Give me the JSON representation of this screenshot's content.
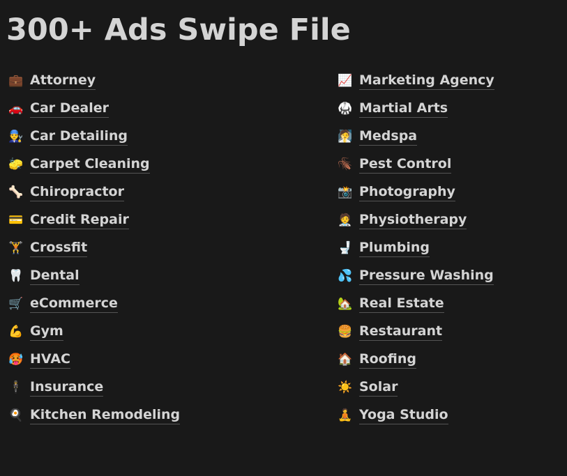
{
  "title": "300+ Ads Swipe File",
  "left_items": [
    {
      "icon": "briefcase-icon",
      "emoji": "💼",
      "label": "Attorney"
    },
    {
      "icon": "car-icon",
      "emoji": "🚗",
      "label": "Car Dealer"
    },
    {
      "icon": "mechanic-icon",
      "emoji": "👨‍🔧",
      "label": "Car Detailing"
    },
    {
      "icon": "sponge-icon",
      "emoji": "🧽",
      "label": "Carpet Cleaning"
    },
    {
      "icon": "bone-icon",
      "emoji": "🦴",
      "label": "Chiropractor"
    },
    {
      "icon": "credit-card-icon",
      "emoji": "💳",
      "label": "Credit Repair"
    },
    {
      "icon": "weightlifter-icon",
      "emoji": "🏋️",
      "label": "Crossfit"
    },
    {
      "icon": "tooth-icon",
      "emoji": "🦷",
      "label": "Dental"
    },
    {
      "icon": "shopping-cart-icon",
      "emoji": "🛒",
      "label": "eCommerce"
    },
    {
      "icon": "flexed-biceps-icon",
      "emoji": "💪",
      "label": "Gym"
    },
    {
      "icon": "hot-face-icon",
      "emoji": "🥵",
      "label": "HVAC"
    },
    {
      "icon": "person-in-suit-icon",
      "emoji": "🕴️",
      "label": "Insurance"
    },
    {
      "icon": "frying-pan-icon",
      "emoji": "🍳",
      "label": "Kitchen Remodeling"
    }
  ],
  "right_items": [
    {
      "icon": "chart-increasing-icon",
      "emoji": "📈",
      "label": "Marketing Agency"
    },
    {
      "icon": "martial-arts-uniform-icon",
      "emoji": "🥋",
      "label": "Martial Arts"
    },
    {
      "icon": "person-in-steamy-room-icon",
      "emoji": "🧖",
      "label": "Medspa"
    },
    {
      "icon": "cockroach-icon",
      "emoji": "🪳",
      "label": "Pest Control"
    },
    {
      "icon": "camera-flash-icon",
      "emoji": "📸",
      "label": "Photography"
    },
    {
      "icon": "health-worker-icon",
      "emoji": "🧑‍⚕️",
      "label": "Physiotherapy"
    },
    {
      "icon": "toilet-icon",
      "emoji": "🚽",
      "label": "Plumbing"
    },
    {
      "icon": "sweat-droplets-icon",
      "emoji": "💦",
      "label": "Pressure Washing"
    },
    {
      "icon": "house-with-garden-icon",
      "emoji": "🏡",
      "label": "Real Estate"
    },
    {
      "icon": "hamburger-icon",
      "emoji": "🍔",
      "label": "Restaurant"
    },
    {
      "icon": "house-icon",
      "emoji": "🏠",
      "label": "Roofing"
    },
    {
      "icon": "sun-icon",
      "emoji": "☀️",
      "label": "Solar"
    },
    {
      "icon": "person-in-lotus-position-icon",
      "emoji": "🧘",
      "label": "Yoga Studio"
    }
  ]
}
